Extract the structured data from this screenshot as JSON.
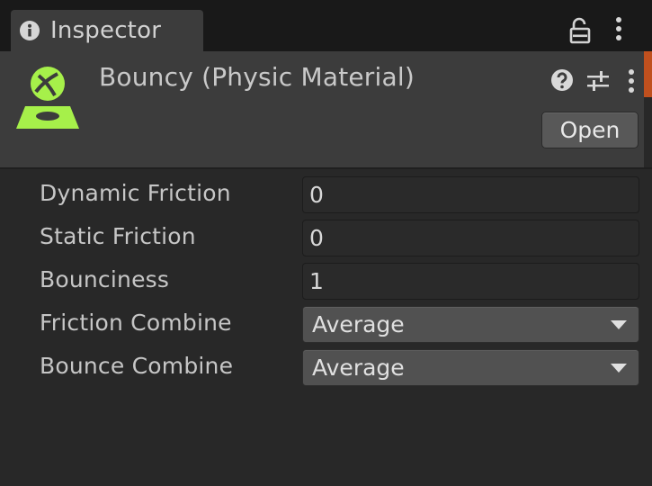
{
  "tab": {
    "label": "Inspector"
  },
  "header": {
    "title": "Bouncy (Physic Material)",
    "open_label": "Open"
  },
  "icons": {
    "tab": "info-icon",
    "lock": "unlocked-icon",
    "menu": "kebab-menu-icon",
    "asset": "physic-material-icon",
    "help": "help-icon",
    "presets": "presets-icon"
  },
  "properties": {
    "dynamic_friction": {
      "label": "Dynamic Friction",
      "value": "0"
    },
    "static_friction": {
      "label": "Static Friction",
      "value": "0"
    },
    "bounciness": {
      "label": "Bounciness",
      "value": "1"
    },
    "friction_combine": {
      "label": "Friction Combine",
      "value": "Average"
    },
    "bounce_combine": {
      "label": "Bounce Combine",
      "value": "Average"
    }
  },
  "colors": {
    "accent": "#c0501e",
    "asset_icon": "#a6f04a",
    "panel": "#282828",
    "header": "#3c3c3c"
  }
}
